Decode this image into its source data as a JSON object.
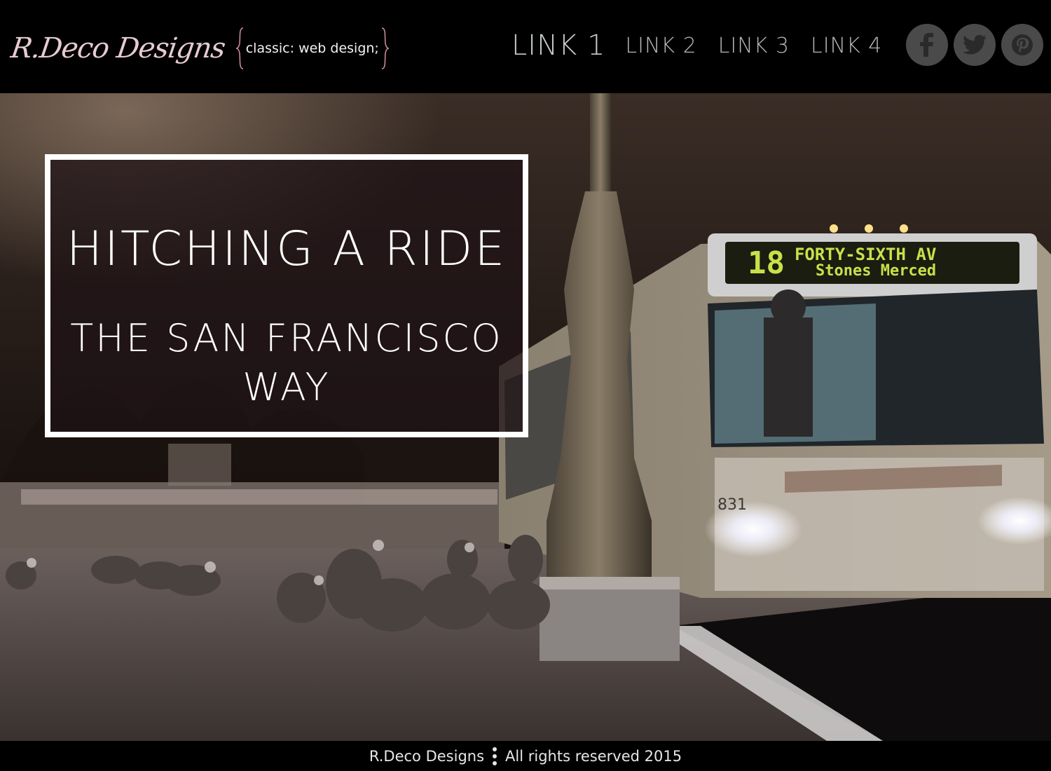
{
  "header": {
    "brand": "R.Deco Designs",
    "tagline": "classic: web design;",
    "nav": [
      {
        "label": "LINK 1",
        "active": true
      },
      {
        "label": "LINK 2",
        "active": false
      },
      {
        "label": "LINK 3",
        "active": false
      },
      {
        "label": "LINK 4",
        "active": false
      }
    ],
    "social": [
      {
        "icon": "facebook-icon"
      },
      {
        "icon": "twitter-icon"
      },
      {
        "icon": "pinterest-icon"
      }
    ]
  },
  "hero": {
    "title": "HITCHING A RIDE",
    "subtitle": "THE SAN FRANCISCO WAY",
    "bus_sign_route": "18",
    "bus_sign_line1": "FORTY-SIXTH AV",
    "bus_sign_line2": "Stones Merced",
    "bus_number": "831"
  },
  "footer": {
    "brand": "R.Deco Designs",
    "rights": "All rights reserved 2015"
  },
  "colors": {
    "header_bg": "#000000",
    "brand_pink": "#e6cbd0",
    "nav_gray": "#b8b8b8",
    "social_bg": "#4a4a4a",
    "box_border": "#ffffff",
    "sign_green": "#c9e04a"
  }
}
